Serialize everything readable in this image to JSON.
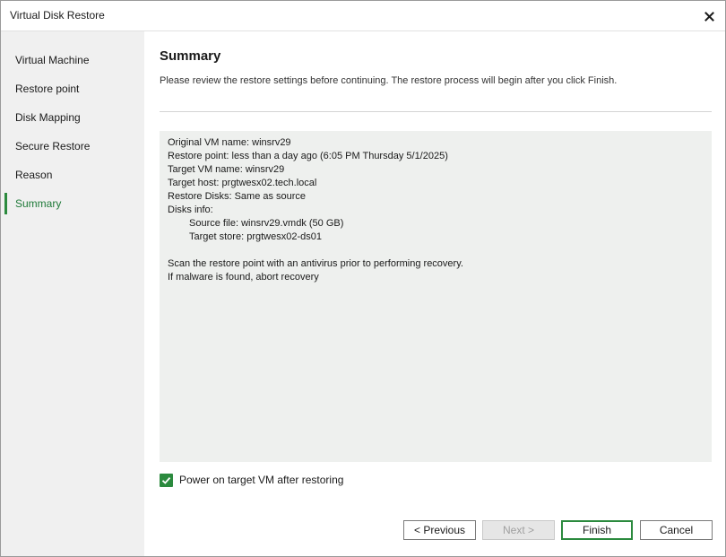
{
  "window": {
    "title": "Virtual Disk Restore",
    "close_icon": "close-icon"
  },
  "sidebar": {
    "items": [
      {
        "label": "Virtual Machine",
        "active": false
      },
      {
        "label": "Restore point",
        "active": false
      },
      {
        "label": "Disk Mapping",
        "active": false
      },
      {
        "label": "Secure Restore",
        "active": false
      },
      {
        "label": "Reason",
        "active": false
      },
      {
        "label": "Summary",
        "active": true
      }
    ]
  },
  "main": {
    "title": "Summary",
    "description": "Please review the restore settings before continuing. The restore process will begin after you click Finish.",
    "summary_lines": [
      "Original VM name: winsrv29",
      "Restore point: less than a day ago (6:05 PM Thursday 5/1/2025)",
      "Target VM name: winsrv29",
      "Target host: prgtwesx02.tech.local",
      "Restore Disks: Same as source",
      "Disks info:",
      "Source file: winsrv29.vmdk (50 GB)",
      "Target store: prgtwesx02-ds01",
      "Scan the restore point with an antivirus prior to performing recovery.",
      "If malware is found, abort recovery"
    ],
    "power_on_checkbox": {
      "label": "Power on target VM after restoring",
      "checked": true
    }
  },
  "footer": {
    "previous_label": "< Previous",
    "next_label": "Next >",
    "finish_label": "Finish",
    "cancel_label": "Cancel"
  },
  "colors": {
    "accent": "#2b8a3e",
    "sidebar_bg": "#f0f0f0",
    "summary_bg": "#eef0ee"
  }
}
